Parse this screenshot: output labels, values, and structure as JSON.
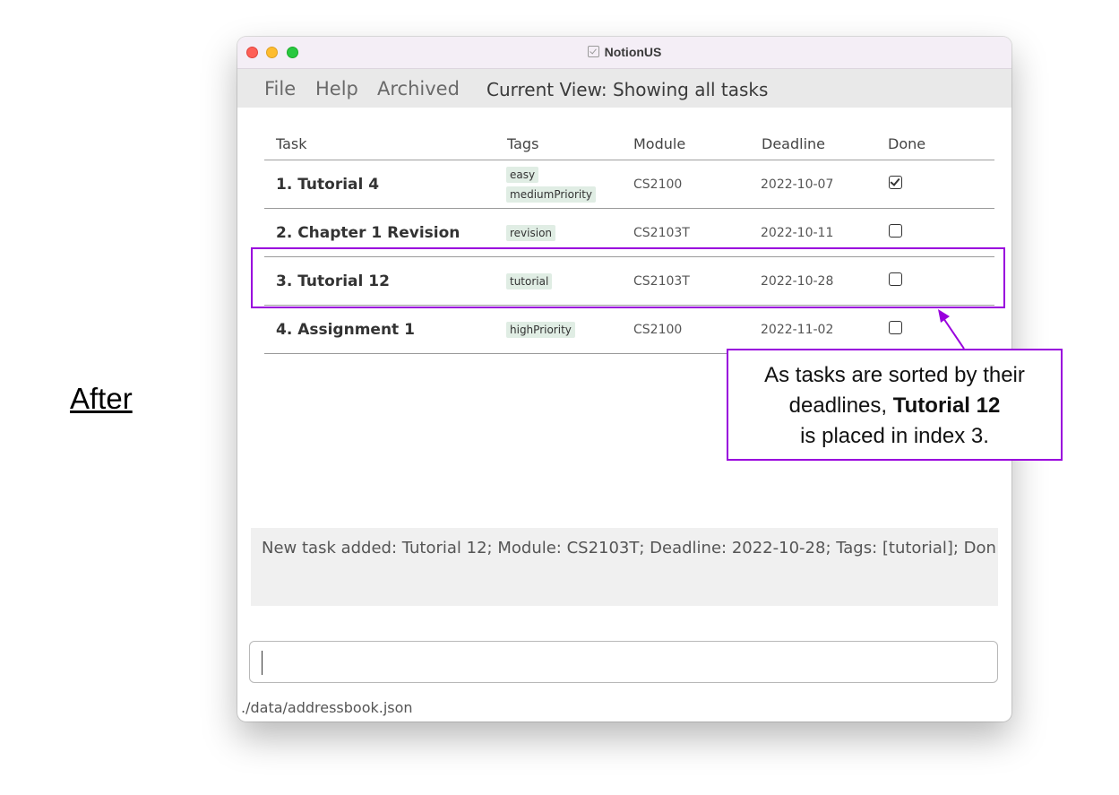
{
  "slide_label": "After",
  "window": {
    "title": "NotionUS"
  },
  "menu": {
    "file": "File",
    "help": "Help",
    "archived": "Archived",
    "current_view": "Current View: Showing all tasks"
  },
  "table": {
    "headers": {
      "task": "Task",
      "tags": "Tags",
      "module": "Module",
      "deadline": "Deadline",
      "done": "Done"
    },
    "rows": [
      {
        "task": "1. Tutorial 4",
        "tags": [
          "easy",
          "mediumPriority"
        ],
        "module": "CS2100",
        "deadline": "2022-10-07",
        "done": true
      },
      {
        "task": "2. Chapter 1 Revision",
        "tags": [
          "revision"
        ],
        "module": "CS2103T",
        "deadline": "2022-10-11",
        "done": false
      },
      {
        "task": "3. Tutorial 12",
        "tags": [
          "tutorial"
        ],
        "module": "CS2103T",
        "deadline": "2022-10-28",
        "done": false
      },
      {
        "task": "4. Assignment 1",
        "tags": [
          "highPriority"
        ],
        "module": "CS2100",
        "deadline": "2022-11-02",
        "done": false
      }
    ]
  },
  "result_display": {
    "text": "New task added: Tutorial 12; Module: CS2103T; Deadline: 2022-10-28; Tags: [tutorial]; Don"
  },
  "command_box": {
    "value": ""
  },
  "status_bar": {
    "path": "./data/addressbook.json"
  },
  "annotation": {
    "line1": "As tasks are sorted by their",
    "line2_prefix": "deadlines, ",
    "line2_bold": "Tutorial 12",
    "line3": "is placed in index 3."
  },
  "colors": {
    "annotation": "#9900dd",
    "tag_background": "#e0ede4",
    "menubar": "#e9e9e9",
    "result_background": "#f0f0f0"
  }
}
